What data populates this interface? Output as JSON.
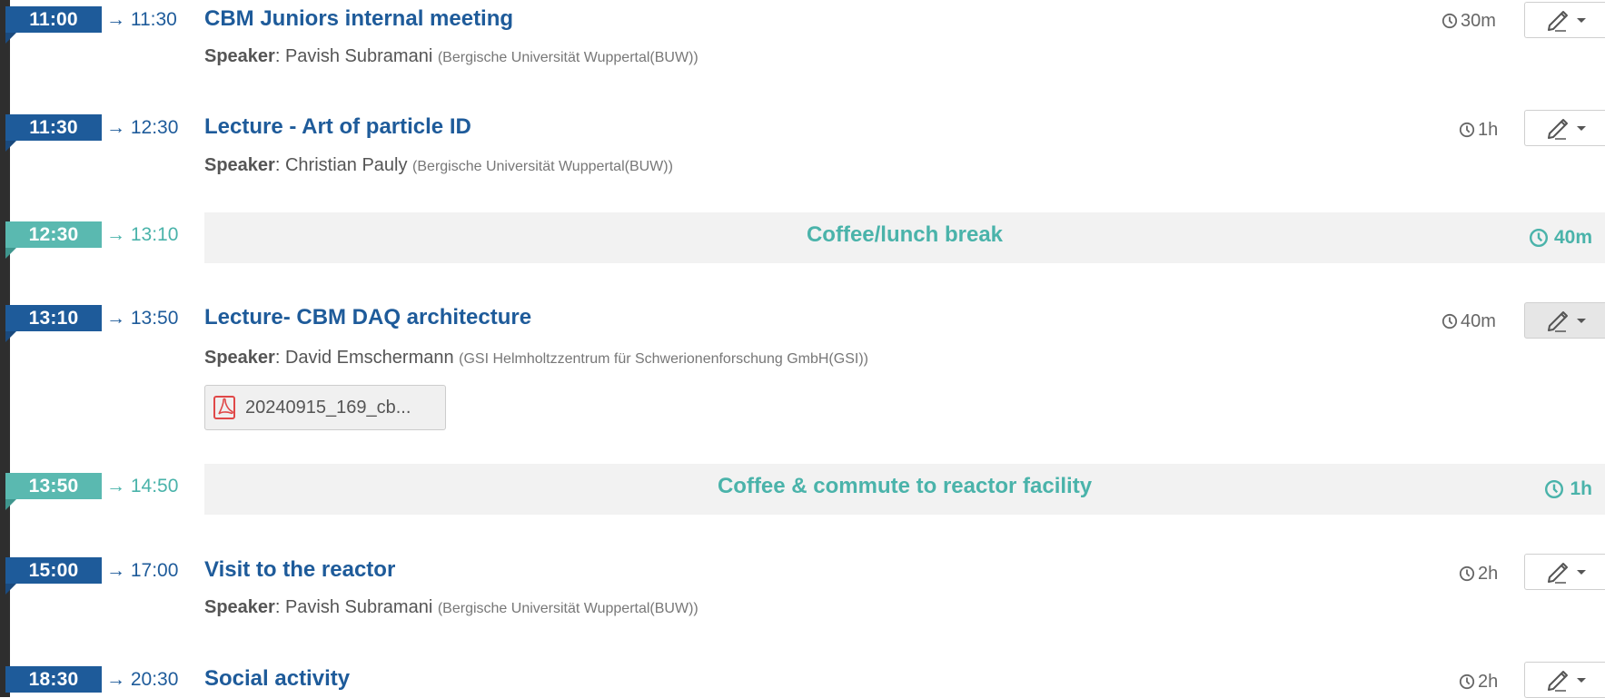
{
  "colors": {
    "talk_badge": "#1e5b9a",
    "break_badge": "#5ab9b0",
    "title": "#1e5b9a",
    "break_text": "#4ab3aa",
    "timeline": "#2e2e2e",
    "pdf_icon": "#e04848"
  },
  "speaker_label": "Speaker",
  "entries": [
    {
      "start": "11:00",
      "end": "→ 11:30",
      "title": "CBM Juniors internal meeting",
      "speaker": "Pavish Subramani",
      "affiliation": "(Bergische Universität Wuppertal(BUW))",
      "duration": "30m",
      "icon": "pencil-icon"
    },
    {
      "start": "11:30",
      "end": "→ 12:30",
      "title": "Lecture - Art of particle ID",
      "speaker": "Christian Pauly",
      "affiliation": "(Bergische Universität Wuppertal(BUW))",
      "duration": "1h",
      "icon": "pencil-icon"
    },
    {
      "start": "12:30",
      "end": "→ 13:10",
      "title": "Coffee/lunch break",
      "duration": "40m",
      "type": "break"
    },
    {
      "start": "13:10",
      "end": "→ 13:50",
      "title": "Lecture- CBM DAQ architecture",
      "speaker": "David Emschermann",
      "affiliation": "(GSI Helmholtzzentrum für Schwerionenforschung GmbH(GSI))",
      "duration": "40m",
      "icon": "pencil-icon",
      "attachment": "20240915_169_cb..."
    },
    {
      "start": "13:50",
      "end": "→ 14:50",
      "title": "Coffee & commute to reactor facility",
      "duration": "1h",
      "type": "break"
    },
    {
      "start": "15:00",
      "end": "→ 17:00",
      "title": "Visit to the reactor",
      "speaker": "Pavish Subramani",
      "affiliation": "(Bergische Universität Wuppertal(BUW))",
      "duration": "2h",
      "icon": "pencil-icon"
    },
    {
      "start": "18:30",
      "end": "→ 20:30",
      "title": "Social activity",
      "duration": "2h",
      "icon": "pencil-icon"
    }
  ]
}
